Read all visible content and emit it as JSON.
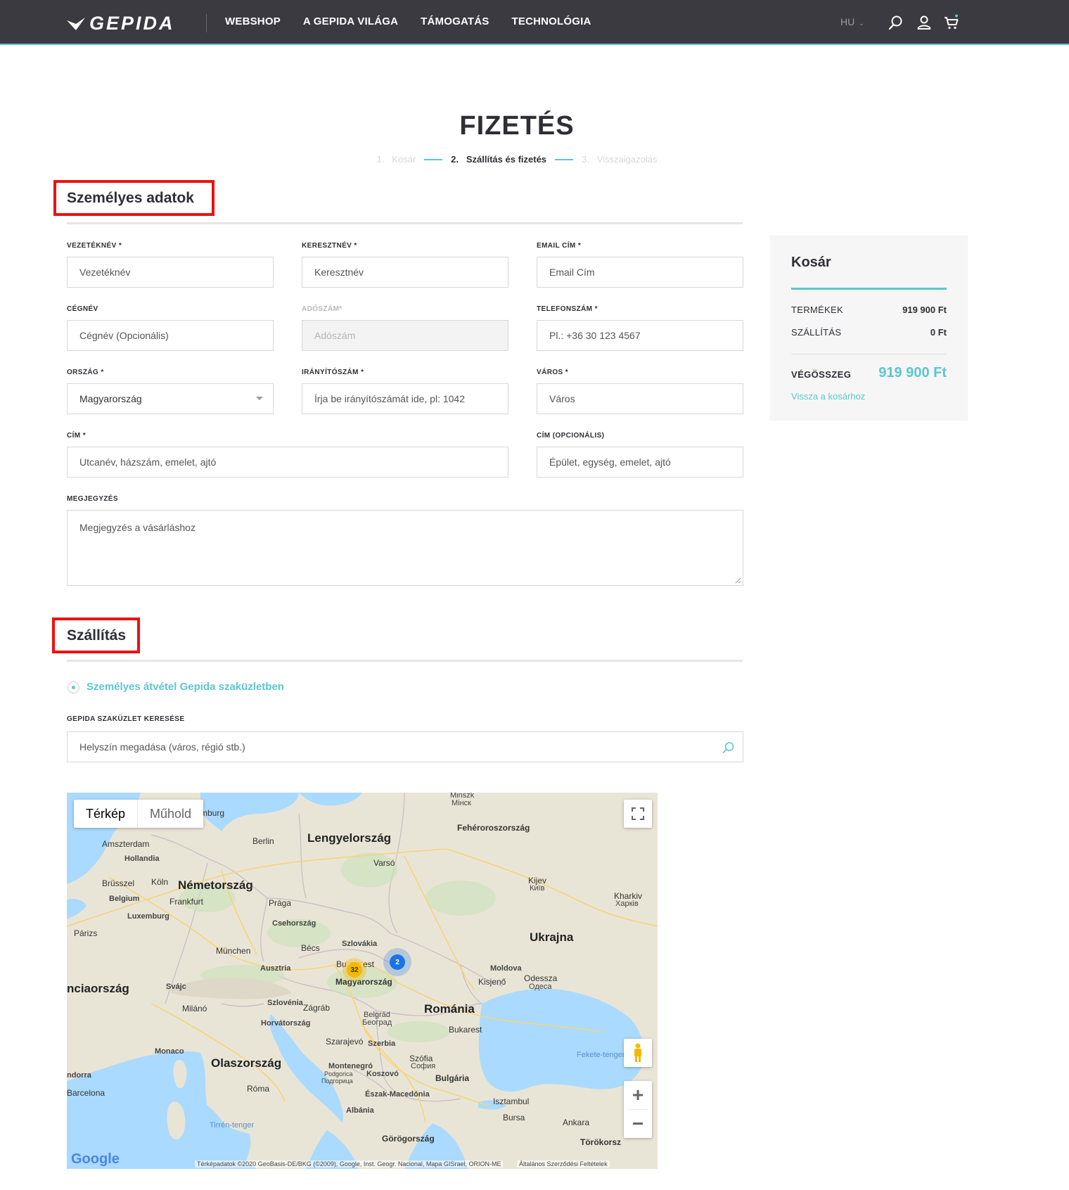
{
  "header": {
    "logo": "GEPIDA",
    "nav": [
      "WEBSHOP",
      "A GEPIDA VILÁGA",
      "TÁMOGATÁS",
      "TECHNOLÓGIA"
    ],
    "lang": "HU",
    "icons": [
      "search-icon",
      "user-icon",
      "cart-icon"
    ],
    "accent_color": "#5cc6d0"
  },
  "page": {
    "title": "FIZETÉS",
    "steps": [
      {
        "num": "1.",
        "label": "Kosár"
      },
      {
        "num": "2.",
        "label": "Szállítás és fizetés"
      },
      {
        "num": "3.",
        "label": "Visszaigazolás"
      }
    ]
  },
  "personal": {
    "title": "Személyes adatok",
    "fields": {
      "lastname": {
        "label": "VEZETÉKNÉV *",
        "placeholder": "Vezetéknév"
      },
      "firstname": {
        "label": "KERESZTNÉV *",
        "placeholder": "Keresztnév"
      },
      "email": {
        "label": "EMAIL CÍM *",
        "placeholder": "Email Cím"
      },
      "company": {
        "label": "CÉGNÉV",
        "placeholder": "Cégnév (Opcionális)"
      },
      "taxnum": {
        "label": "ADÓSZÁM*",
        "placeholder": "Adószám"
      },
      "phone": {
        "label": "TELEFONSZÁM *",
        "placeholder": "Pl.: +36 30 123 4567"
      },
      "country": {
        "label": "ORSZÁG *",
        "value": "Magyarország"
      },
      "zip": {
        "label": "IRÁNYÍTÓSZÁM *",
        "placeholder": "Írja be irányítószámát ide, pl: 1042"
      },
      "city": {
        "label": "VÁROS *",
        "placeholder": "Város"
      },
      "address": {
        "label": "CÍM *",
        "placeholder": "Utcanév, házszám, emelet, ajtó"
      },
      "address2": {
        "label": "CÍM (OPCIONÁLIS)",
        "placeholder": "Épület, egység, emelet, ajtó"
      },
      "note": {
        "label": "MEGJEGYZÉS",
        "placeholder": "Megjegyzés a vásárláshoz"
      }
    }
  },
  "cart": {
    "title": "Kosár",
    "products_label": "TERMÉKEK",
    "products_value": "919 900 Ft",
    "shipping_label": "SZÁLLÍTÁS",
    "shipping_value": "0 Ft",
    "total_label": "VÉGÖSSZEG",
    "total_value": "919 900 Ft",
    "back_link": "Vissza a kosárhoz"
  },
  "shipping": {
    "title": "Szállítás",
    "option": "Személyes átvétel Gepida szaküzletben",
    "search_label": "GEPIDA SZAKÜZLET KERESÉSE",
    "search_placeholder": "Helyszín megadása (város, régió stb.)"
  },
  "map": {
    "type_map": "Térkép",
    "type_sat": "Műhold",
    "clusters": [
      {
        "count": "32",
        "color": "#f5b800"
      },
      {
        "count": "2",
        "color": "#1a73e8"
      }
    ],
    "labels": {
      "minszk": "Minszk",
      "minszk_cy": "Мінск",
      "feher": "Fehéroroszország",
      "lengyel": "Lengyelország",
      "berlin": "Berlin",
      "hamburg": "mburg",
      "amszterdam": "Amszterdam",
      "hollandia": "Hollandia",
      "varso": "Varsó",
      "brussel": "Brüsszel",
      "koln": "Köln",
      "nemet": "Németország",
      "belgium": "Belgium",
      "frankfurt": "Frankfurt",
      "kijev": "Kijev",
      "kijev_cy": "Київ",
      "kharkiv": "Kharkiv",
      "kharkiv_cy": "Харків",
      "praga": "Prága",
      "luxemburg": "Luxemburg",
      "cseh": "Csehország",
      "parizs": "Párizs",
      "ukrajna": "Ukrajna",
      "szlovakia": "Szlovákia",
      "munchen": "München",
      "becs": "Bécs",
      "ausztria": "Ausztria",
      "budapest_a": "Bu",
      "budapest_b": "est",
      "moldova": "Moldova",
      "odessza": "Odessza",
      "odessza_cy": "Одеса",
      "kisjeno": "Kisjenő",
      "magyar": "Magyarország",
      "francia": "nciaország",
      "svajc": "Svájc",
      "szlovenia": "Szlovénia",
      "zagrab": "Zágráb",
      "romania": "Románia",
      "milano": "Milánó",
      "belgrad": "Belgrád",
      "belgrad_cy": "Београд",
      "horvat": "Horvátország",
      "bukarest": "Bukarest",
      "szarajevo": "Szarajevó",
      "szerbia": "Szerbia",
      "monaco": "Monaco",
      "fekete": "Fekete-tenger",
      "olasz": "Olaszország",
      "szofia": "Szófia",
      "szofia_cy": "София",
      "montenegro": "Montenegró",
      "podgorica": "Podgorica",
      "podgorica_cy": "Подгорица",
      "koszovo": "Koszovó",
      "bulgaria": "Bulgária",
      "andorra": "ndorra",
      "roma": "Róma",
      "barcelona": "Barcelona",
      "eszakmac": "Észak-Macedónia",
      "isztambul": "Isztambul",
      "albania": "Albánia",
      "tirren": "Tirrén-tenger",
      "bursa": "Bursa",
      "ankara": "Ankara",
      "gorog": "Görögország",
      "torok": "Törökorsz"
    },
    "attribution": "Térképadatok ©2020 GeoBasis-DE/BKG (©2009), Google, Inst. Geogr. Nacional, Mapa GISrael, ORION-ME",
    "terms": "Általános Szerződési Feltételek",
    "google": "Google"
  }
}
